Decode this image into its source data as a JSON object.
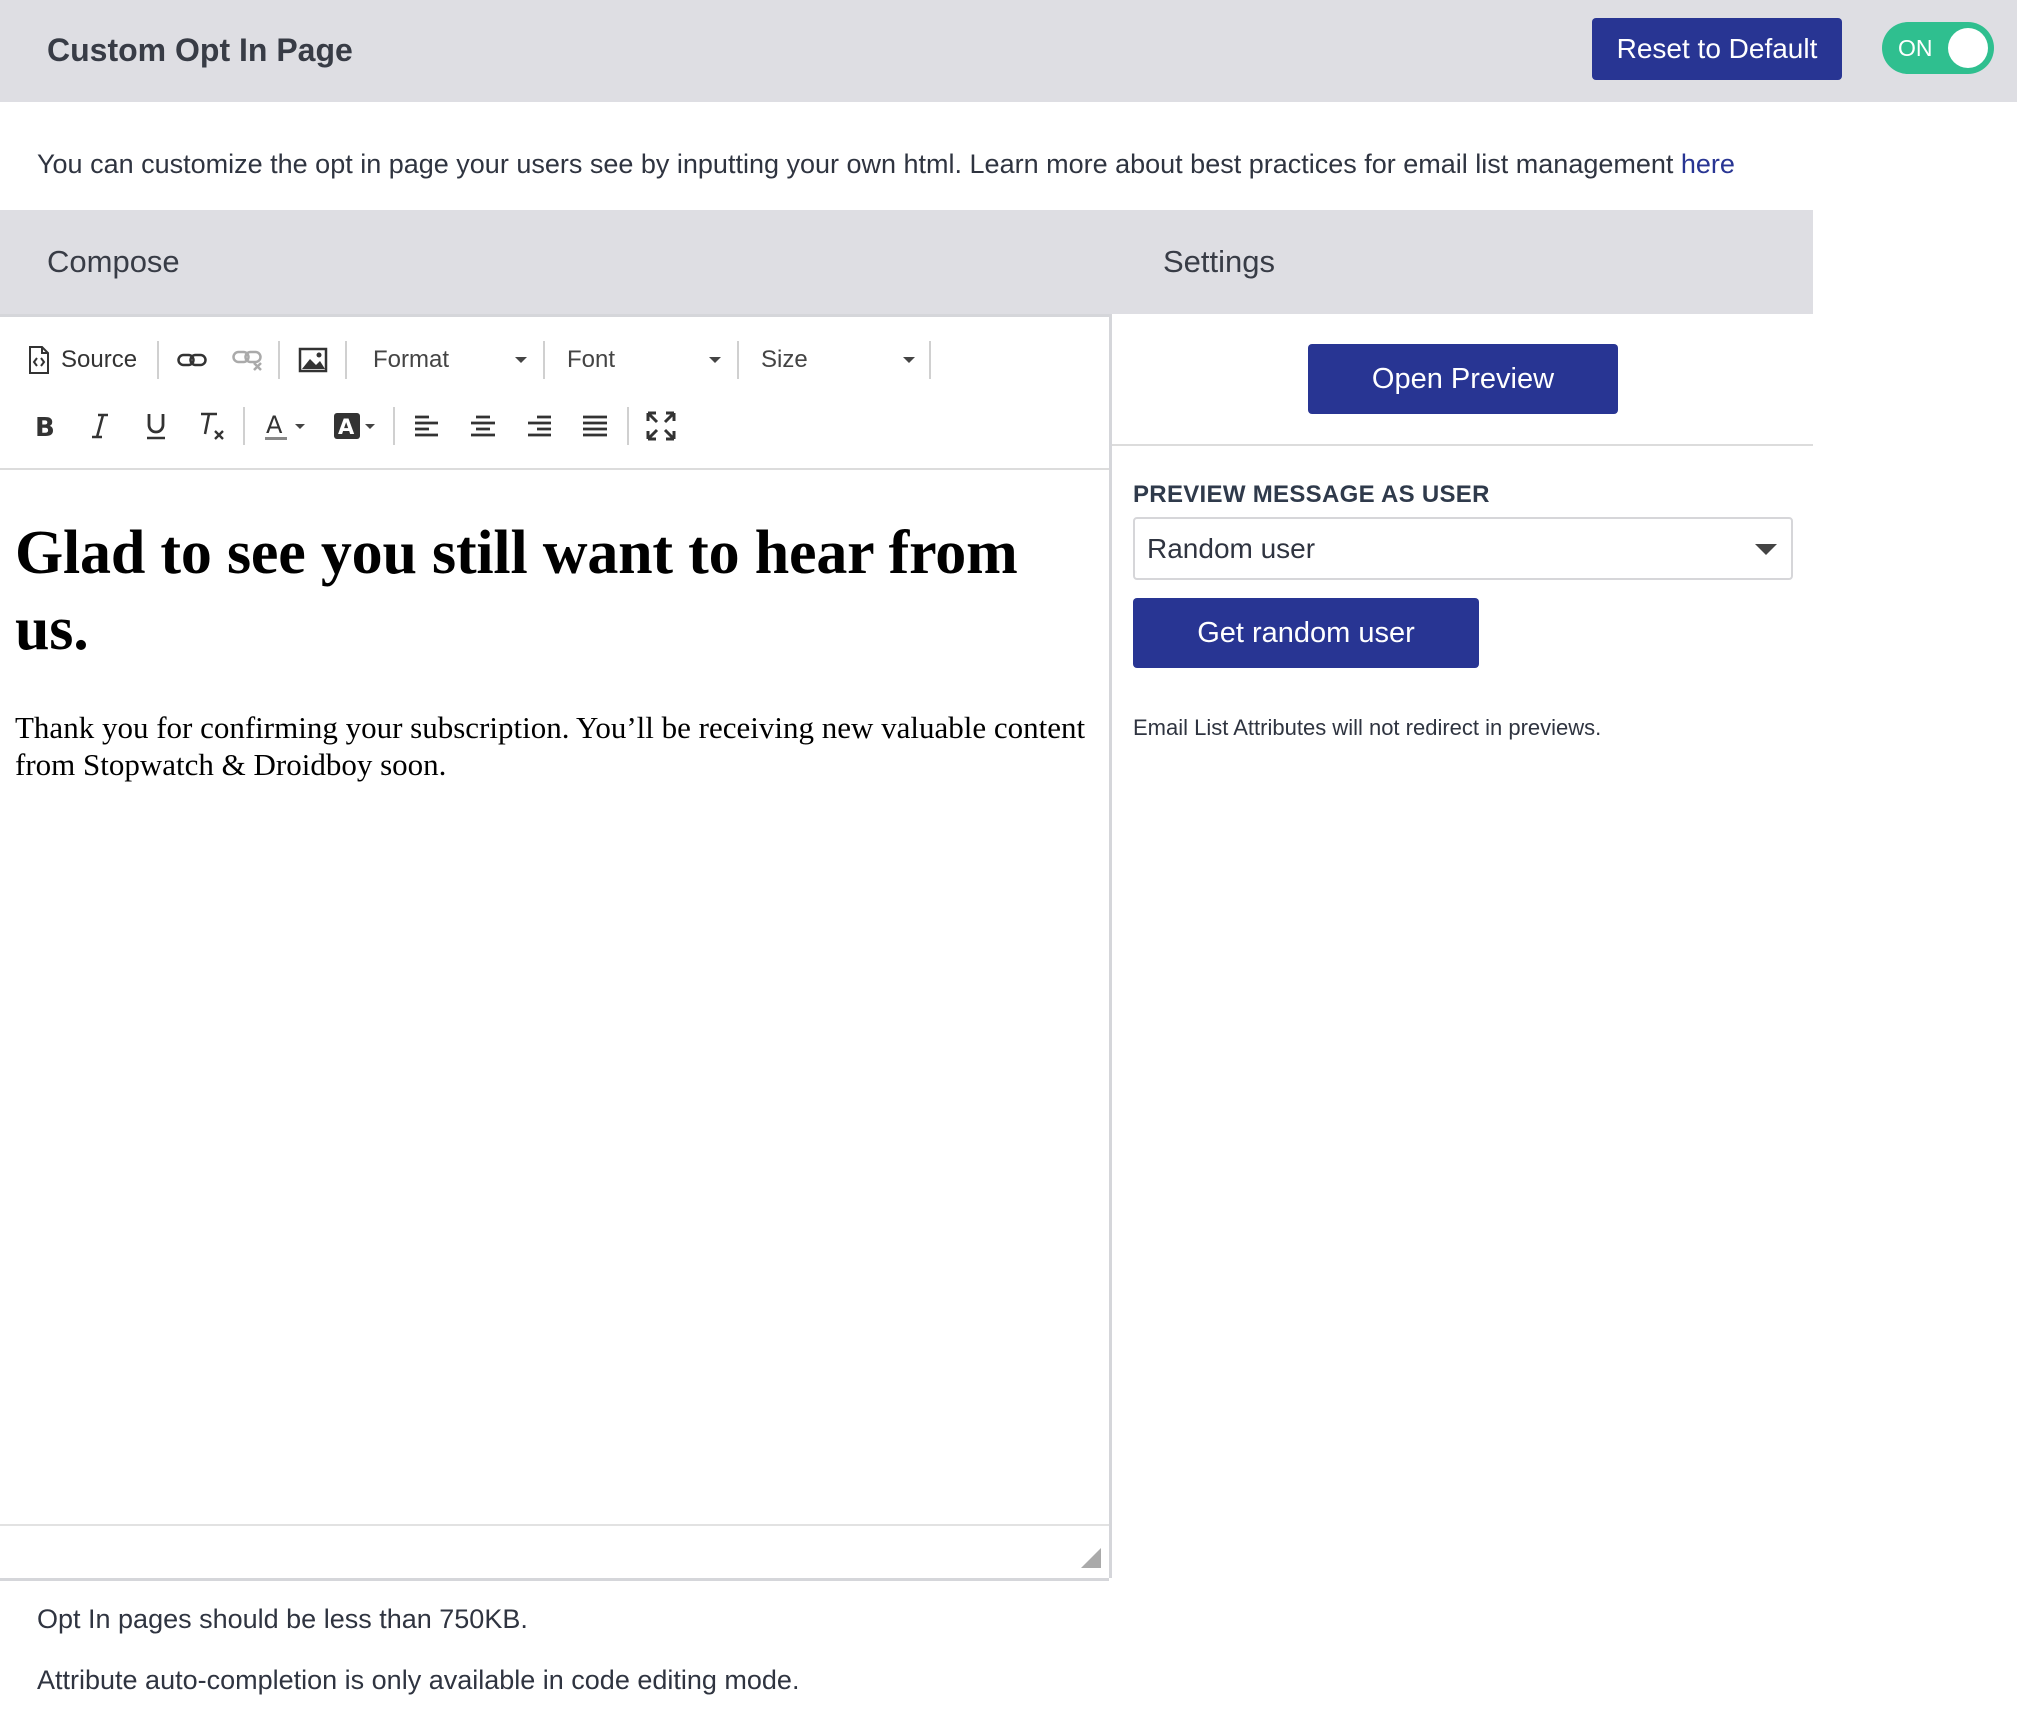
{
  "header": {
    "title": "Custom Opt In Page",
    "reset_label": "Reset to Default",
    "toggle_label": "ON",
    "toggle_on": true
  },
  "intro": {
    "text": "You can customize the opt in page your users see by inputting your own html. Learn more about best practices for email list management ",
    "link_label": "here"
  },
  "columns": {
    "compose": "Compose",
    "settings": "Settings"
  },
  "toolbar": {
    "source_label": "Source",
    "format_label": "Format",
    "font_label": "Font",
    "size_label": "Size",
    "text_color_glyph": "A",
    "bg_color_glyph": "A"
  },
  "editor": {
    "heading": "Glad to see you still want to hear from us.",
    "body": "Thank you for confirming your subscription. You’ll be receiving new valuable content from Stopwatch & Droidboy soon."
  },
  "notes": {
    "size_limit": "Opt In pages should be less than 750KB.",
    "autocomplete": "Attribute auto-completion is only available in code editing mode."
  },
  "settings": {
    "open_preview_label": "Open Preview",
    "preview_as_label": "PREVIEW MESSAGE AS USER",
    "user_select_value": "Random user",
    "get_random_label": "Get random user",
    "redirect_note": "Email List Attributes will not redirect in previews."
  },
  "colors": {
    "primary": "#283593",
    "toggle_on": "#2fbf8f",
    "header_bg": "#dedee3"
  }
}
